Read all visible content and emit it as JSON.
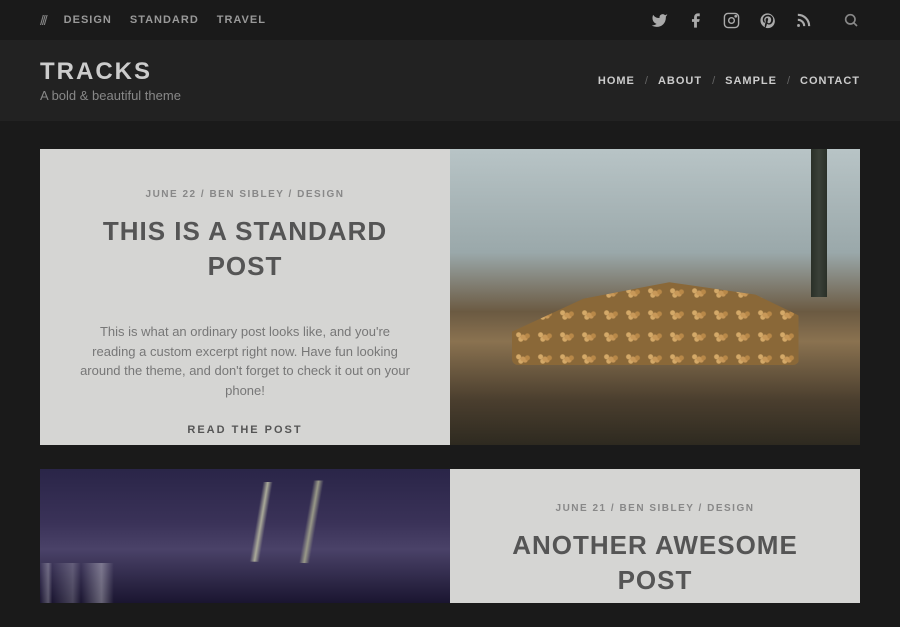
{
  "topbar": {
    "categories": [
      "DESIGN",
      "STANDARD",
      "TRAVEL"
    ]
  },
  "site": {
    "title": "TRACKS",
    "tagline": "A bold & beautiful theme"
  },
  "nav": {
    "items": [
      "HOME",
      "ABOUT",
      "SAMPLE",
      "CONTACT"
    ]
  },
  "posts": [
    {
      "date": "JUNE 22",
      "author": "BEN SIBLEY",
      "category": "DESIGN",
      "title": "THIS IS A STANDARD POST",
      "excerpt": "This is what an ordinary post looks like, and you're reading a custom excerpt right now. Have fun looking around the theme, and don't forget to check it out on your phone!",
      "read_more": "READ THE POST"
    },
    {
      "date": "JUNE 21",
      "author": "BEN SIBLEY",
      "category": "DESIGN",
      "title": "ANOTHER AWESOME POST"
    }
  ],
  "meta_sep": " / "
}
